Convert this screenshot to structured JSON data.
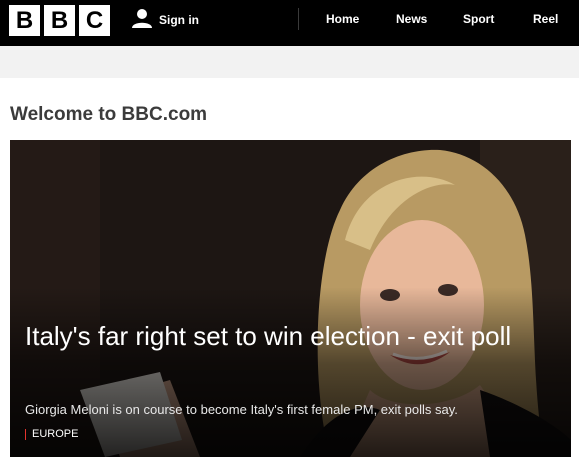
{
  "header": {
    "logo_letters": [
      "B",
      "B",
      "C"
    ],
    "signin_label": "Sign in",
    "nav": [
      "Home",
      "News",
      "Sport",
      "Reel"
    ]
  },
  "welcome": "Welcome to BBC.com",
  "hero": {
    "headline": "Italy's far right set to win election - exit poll",
    "summary": "Giorgia Meloni is on course to become Italy's first female PM, exit polls say.",
    "section": "EUROPE",
    "section_color": "#e3332d"
  },
  "icons": {
    "signin": "user-icon"
  }
}
